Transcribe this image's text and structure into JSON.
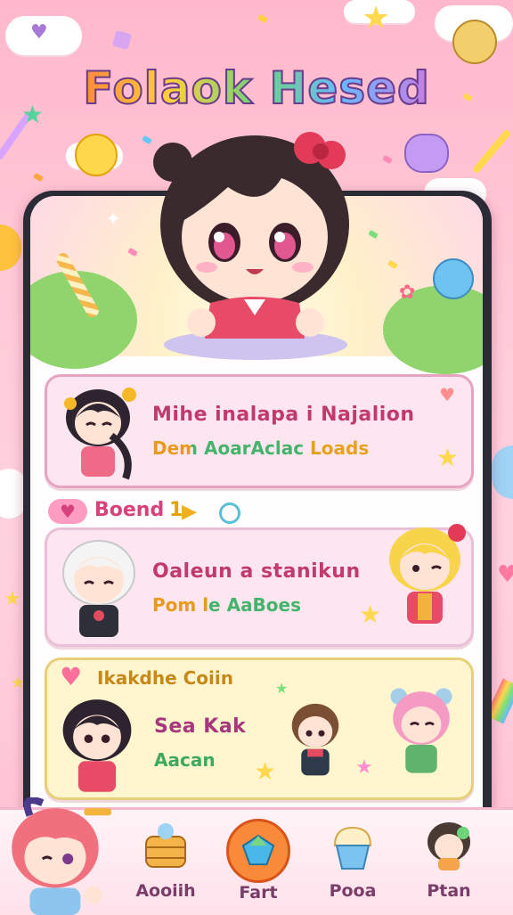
{
  "app": {
    "title": "Folaok Hesed"
  },
  "cards": [
    {
      "title": "Mihe inalapa i Najalion",
      "subtitle": "Dem AoarAclac Loads"
    },
    {
      "title": "Oaleun a stanikun",
      "subtitle": "Pom le AaBoes"
    },
    {
      "title": "Sea Kak",
      "subtitle": "Aacan"
    }
  ],
  "sections": {
    "boend_label": "Boend",
    "boend_count": "1",
    "second_label": "Ikakdhe Coiin"
  },
  "tabs": [
    {
      "label": "Aooiih",
      "icon": "basket-icon"
    },
    {
      "label": "Fart",
      "icon": "gem-icon"
    },
    {
      "label": "Pooa",
      "icon": "cupcake-icon"
    },
    {
      "label": "Ptan",
      "icon": "character-icon"
    }
  ],
  "colors": {
    "background": "#ffc9d6",
    "accent_pink": "#d6437c",
    "card_pink": "#fde6ef",
    "card_yellow": "#fff6cf",
    "phone_frame": "#2b2b36"
  }
}
